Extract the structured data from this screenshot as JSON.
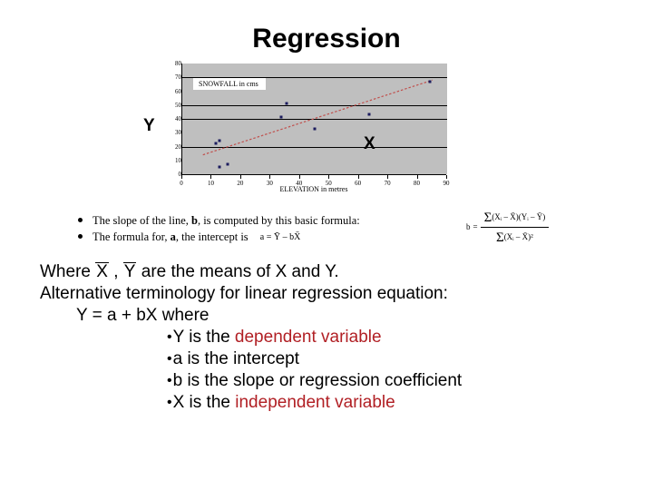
{
  "slide": {
    "title": "Regression"
  },
  "chart_data": {
    "type": "scatter",
    "title": "",
    "series_label": "SNOWFALL in cms",
    "xlabel": "ELEVATION in metres",
    "ylabel": "SNOWFALL in cms",
    "y_axis_outer_label": "Y",
    "x_axis_inner_label": "X",
    "xlim": [
      0,
      90
    ],
    "ylim": [
      0,
      80
    ],
    "xticks": [
      "0",
      "10",
      "20",
      "30",
      "40",
      "50",
      "60",
      "70",
      "80",
      "90"
    ],
    "yticks": [
      "80",
      "70",
      "60",
      "50",
      "40",
      "30",
      "20",
      "10",
      "0"
    ],
    "grid": true,
    "legend_position": "inside-top-left",
    "plot_background": "#bfbfbf",
    "point_color": "#1b1b5e",
    "trendline_color": "#c0504d",
    "points": [
      {
        "x": 11.5,
        "y": 22
      },
      {
        "x": 12.5,
        "y": 24
      },
      {
        "x": 12.5,
        "y": 5
      },
      {
        "x": 15.5,
        "y": 7
      },
      {
        "x": 33.5,
        "y": 41
      },
      {
        "x": 35.5,
        "y": 51
      },
      {
        "x": 45.0,
        "y": 33
      },
      {
        "x": 63.5,
        "y": 43
      },
      {
        "x": 84.0,
        "y": 67
      }
    ],
    "trendline": {
      "x0": 7,
      "y0": 14,
      "x1": 85,
      "y1": 68
    }
  },
  "formula_bullets": [
    {
      "text_before": "The slope of the line, ",
      "bold": "b",
      "text_after": ", is computed by this basic formula:",
      "formula": {
        "lhs": "b",
        "equals": "=",
        "numerator": "Σ (Xᵢ – X̄)(Yᵢ – Ȳ)",
        "denominator": "Σ (Xᵢ – X̄)²"
      }
    },
    {
      "text_before": "The formula for, ",
      "bold": "a",
      "text_after": ", the intercept is",
      "inline_formula": "a = Ȳ – bX̄"
    }
  ],
  "formula_parts": {
    "b_symbol": "b",
    "equals": "=",
    "num_sum": "Σ",
    "num_rest": "(Xᵢ – X̄)(Yᵢ – Ȳ)",
    "den_sum": "Σ",
    "den_rest": "(Xᵢ – X̄)²",
    "intercept": "a = Ȳ – bX̄"
  },
  "body": {
    "line1_a": "Where ",
    "line1_xbar": "X",
    "line1_mid": " , ",
    "line1_ybar": "Y",
    "line1_b": " are the means of X and Y.",
    "line2": "Alternative terminology for linear regression equation:",
    "line3": "Y = a + bX   where",
    "bullets": [
      {
        "plain": "Y is the ",
        "red": "dependent variable"
      },
      {
        "plain": "a is the intercept",
        "red": ""
      },
      {
        "plain": "b is the slope or regression coefficient",
        "red": ""
      },
      {
        "plain": "X is the ",
        "red": "independent variable"
      }
    ],
    "bullet_glyph": "•",
    "red_color": "#b11f24"
  }
}
